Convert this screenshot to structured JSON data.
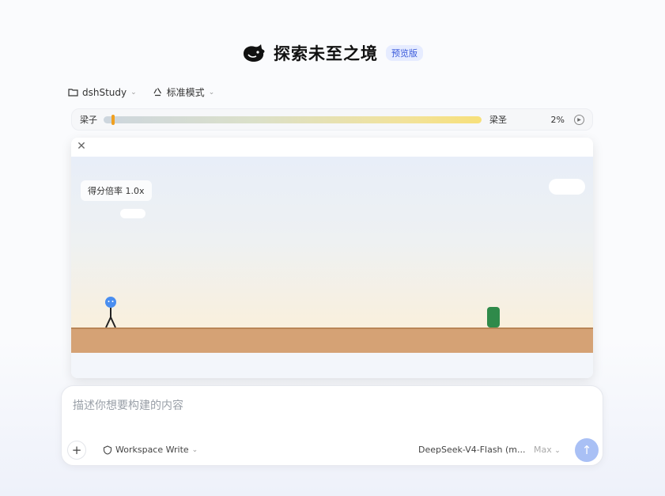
{
  "header": {
    "title": "探索未至之境",
    "badge": "预览版",
    "logo_icon": "whale-icon"
  },
  "toolbar": {
    "folder_label": "dshStudy",
    "mode_label": "标准模式"
  },
  "progress": {
    "left_label": "梁子",
    "right_label": "梁圣",
    "percent_text": "2%",
    "percent_value": 0.02
  },
  "game": {
    "score_label": "得分倍率 1.0x",
    "close_icon": "close-icon",
    "colors": {
      "ground": "#d5a275",
      "cactus": "#2f8a4a",
      "player": "#4a8ef0"
    }
  },
  "composer": {
    "placeholder": "描述你想要构建的内容",
    "workspace_label": "Workspace Write",
    "model_label": "DeepSeek-V4-Flash (m...",
    "effort_label": "Max",
    "send_icon": "arrow-up-icon",
    "accent": "#a9c0f5"
  }
}
